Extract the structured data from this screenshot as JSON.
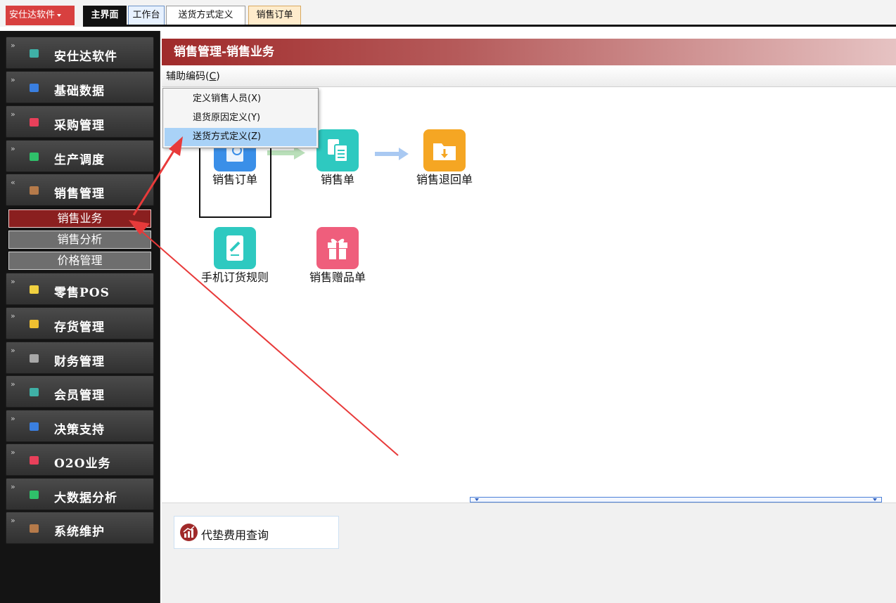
{
  "topbar": {
    "app_menu": "安仕达软件",
    "tabs": [
      "主界面",
      "工作台",
      "送货方式定义",
      "销售订单"
    ]
  },
  "sidebar": {
    "items": [
      {
        "label": "安仕达软件",
        "icon": "teal-square-icon",
        "color": "#3fb0a6"
      },
      {
        "label": "基础数据",
        "icon": "blue-square-icon",
        "color": "#3a7fe0"
      },
      {
        "label": "采购管理",
        "icon": "red-square-icon",
        "color": "#e8405a"
      },
      {
        "label": "生产调度",
        "icon": "green-square-icon",
        "color": "#2fc06a"
      },
      {
        "label": "销售管理",
        "icon": "brown-square-icon",
        "color": "#b57a4a"
      },
      {
        "label": "零售POS",
        "icon": "yellow-square-icon",
        "color": "#f0d040"
      },
      {
        "label": "存货管理",
        "icon": "orange-square-icon",
        "color": "#f0c030"
      },
      {
        "label": "财务管理",
        "icon": "gray-square-icon",
        "color": "#a8a8a8"
      },
      {
        "label": "会员管理",
        "icon": "teal-square-icon",
        "color": "#3fb0a6"
      },
      {
        "label": "决策支持",
        "icon": "blue-square-icon",
        "color": "#3a7fe0"
      },
      {
        "label": "O2O业务",
        "icon": "red-square-icon",
        "color": "#e8405a"
      },
      {
        "label": "大数据分析",
        "icon": "green-square-icon",
        "color": "#2fc06a"
      },
      {
        "label": "系统维护",
        "icon": "brown-square-icon",
        "color": "#b57a4a"
      }
    ],
    "sub_items": [
      "销售业务",
      "销售分析",
      "价格管理"
    ]
  },
  "main": {
    "title": "销售管理-销售业务",
    "menu_label": "辅助编码(",
    "menu_hotkey": "C",
    "menu_close": ")",
    "dropdown": [
      "定义销售人员(X)",
      "退货原因定义(Y)",
      "送货方式定义(Z)"
    ],
    "functions": [
      {
        "label": "销售订单",
        "icon": "sales-order-icon",
        "color": "#3a8fe8"
      },
      {
        "label": "销售单",
        "icon": "sales-slip-icon",
        "color": "#2ec9c0"
      },
      {
        "label": "销售退回单",
        "icon": "sales-return-icon",
        "color": "#f5a623"
      },
      {
        "label": "手机订货规则",
        "icon": "mobile-order-rule-icon",
        "color": "#2ec9c0"
      },
      {
        "label": "销售赠品单",
        "icon": "gift-icon",
        "color": "#ef5e7c"
      }
    ],
    "bottom_button": "代垫费用查询"
  },
  "colors": {
    "accent_red": "#a02a2a",
    "annotation_arrow": "#e83a3a"
  }
}
